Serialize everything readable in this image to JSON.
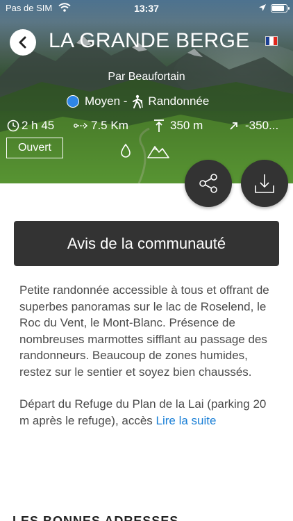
{
  "status_bar": {
    "carrier": "Pas de SIM",
    "time": "13:37",
    "battery_level": 0.95
  },
  "header": {
    "title": "LA GRANDE BERGE",
    "author": "Par Beaufortain",
    "language_flag": "flag-france-icon"
  },
  "trail": {
    "difficulty": "Moyen -",
    "difficulty_color": "#2f86e6",
    "activity": "Randonnée",
    "duration": "2 h 45",
    "distance": "7.5 Km",
    "elevation_gain": "350 m",
    "elevation_loss": "-350...",
    "status": "Ouvert"
  },
  "actions": {
    "community_label": "Avis de la communauté"
  },
  "description": {
    "paragraph1": "Petite randonnée accessible à tous et offrant de superbes panoramas sur le lac de Roselend, le Roc du Vent, le Mont-Blanc. Présence de nombreuses marmottes sifflant au passage des randonneurs. Beaucoup de zones humides, restez sur le sentier et soyez bien chaussés.",
    "paragraph2": "Départ du Refuge du Plan de la Lai (parking 20 m après le refuge), accès ",
    "read_more": "Lire la suite"
  },
  "next_section": {
    "title": "LES BONNES ADRESSES"
  },
  "colors": {
    "accent_link": "#1a7fd6",
    "dark_button": "#333333"
  }
}
